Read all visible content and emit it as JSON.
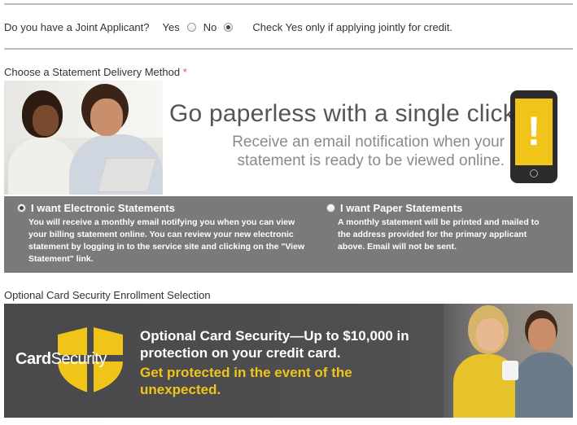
{
  "joint": {
    "question": "Do you have a Joint Applicant?",
    "yes_label": "Yes",
    "no_label": "No",
    "hint": "Check Yes only if applying jointly for credit.",
    "selected": "No"
  },
  "statement": {
    "label": "Choose a Statement Delivery Method",
    "required_mark": "*",
    "banner_title": "Go paperless with a single click.",
    "banner_subtitle": "Receive an email notification when your statement is ready to be viewed online.",
    "phone_glyph": "!",
    "electronic": {
      "label": "I want Electronic Statements",
      "description": "You will receive a monthly email notifying you when you can view your billing statement online. You can review your new electronic statement by logging in to the service site and clicking on the \"View Statement\" link.",
      "checked": true
    },
    "paper": {
      "label": "I want Paper Statements",
      "description": "A monthly statement will be printed and mailed to the address provided for the primary applicant above. Email will not be sent.",
      "checked": false
    }
  },
  "card_security": {
    "label": "Optional Card Security Enrollment Selection",
    "logo_bold": "Card",
    "logo_thin": "Security",
    "headline": "Optional Card Security—Up to $10,000 in protection on your credit card.",
    "tagline": "Get protected in the event of the unexpected."
  },
  "colors": {
    "accent_yellow": "#f0c419",
    "delivery_bg": "#7a7a7a",
    "banner_dark": "#4a4a4c",
    "required": "#d9534f"
  }
}
